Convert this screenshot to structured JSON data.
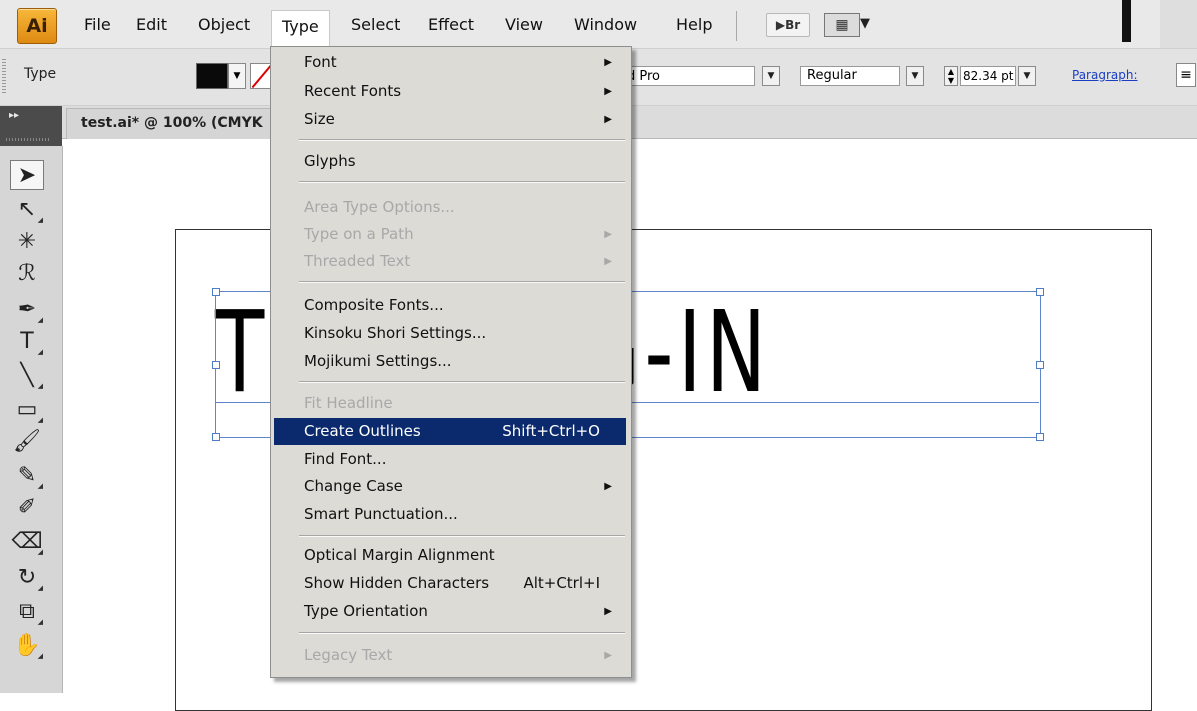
{
  "app": {
    "logo_text": "Ai"
  },
  "menubar": {
    "items": [
      "File",
      "Edit",
      "Object",
      "Type",
      "Select",
      "Effect",
      "View",
      "Window",
      "Help"
    ],
    "bridge_label": "Br"
  },
  "controlbar": {
    "type_label": "Type",
    "font_name": "d Pro",
    "font_style": "Regular",
    "font_size": "82.34 pt",
    "paragraph_label": "Paragraph:"
  },
  "document": {
    "tab_title": "test.ai* @ 100% (CMYK"
  },
  "canvas": {
    "art_text": "T             AI PLUG-IN"
  },
  "type_menu": {
    "items": [
      {
        "label": "Font",
        "submenu": true
      },
      {
        "label": "Recent Fonts",
        "submenu": true
      },
      {
        "label": "Size",
        "submenu": true
      },
      {
        "label": "Glyphs"
      },
      {
        "label": "Area Type Options...",
        "disabled": true
      },
      {
        "label": "Type on a Path",
        "submenu": true,
        "disabled": true
      },
      {
        "label": "Threaded Text",
        "submenu": true,
        "disabled": true
      },
      {
        "label": "Composite Fonts..."
      },
      {
        "label": "Kinsoku Shori Settings..."
      },
      {
        "label": "Mojikumi Settings..."
      },
      {
        "label": "Fit Headline",
        "disabled": true
      },
      {
        "label": "Create Outlines",
        "shortcut": "Shift+Ctrl+O",
        "highlighted": true
      },
      {
        "label": "Find Font..."
      },
      {
        "label": "Change Case",
        "submenu": true
      },
      {
        "label": "Smart Punctuation..."
      },
      {
        "label": "Optical Margin Alignment"
      },
      {
        "label": "Show Hidden Characters",
        "shortcut": "Alt+Ctrl+I"
      },
      {
        "label": "Type Orientation",
        "submenu": true
      },
      {
        "label": "Legacy Text",
        "submenu": true,
        "disabled": true
      }
    ]
  },
  "colors": {
    "menu_highlight": "#0b2a6d",
    "selection_blue": "#5f86c9",
    "logo_orange": "#de8a12"
  }
}
